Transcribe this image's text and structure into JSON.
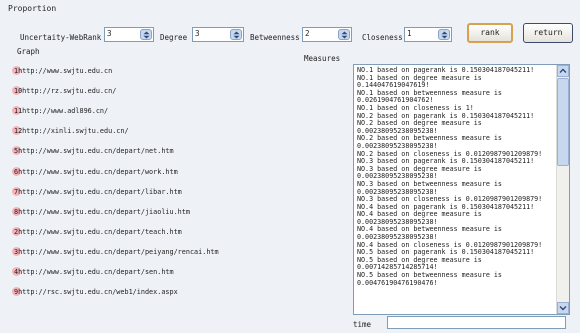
{
  "title": "Proportion",
  "weights": [
    {
      "label": "Uncertaity-WebRank",
      "value": "3"
    },
    {
      "label": "Degree",
      "value": "3"
    },
    {
      "label": "Betweenness",
      "value": "2"
    },
    {
      "label": "Closeness",
      "value": "1"
    }
  ],
  "buttons": {
    "rank": "rank",
    "return": "return"
  },
  "graph": {
    "label": "Graph",
    "items": [
      "1http://www.swjtu.edu.cn",
      "10http://rz.swjtu.edu.cn/",
      "11http://www.adl896.cn/",
      "12http://xinli.swjtu.edu.cn/",
      "5http://www.swjtu.edu.cn/depart/net.htm",
      "6http://www.swjtu.edu.cn/depart/work.htm",
      "7http://www.swjtu.edu.cn/depart/libar.htm",
      "8http://www.swjtu.edu.cn/depart/jiaoliu.htm",
      "2http://www.swjtu.edu.cn/depart/teach.htm",
      "3http://www.swjtu.edu.cn/depart/peiyang/rencai.htm",
      "4http://www.swjtu.edu.cn/depart/sen.htm",
      "9http://rsc.swjtu.edu.cn/web1/index.aspx"
    ]
  },
  "measures": {
    "label": "Measures",
    "lines": [
      "NO.1 based on pagerank is 0.150304187045211!",
      "NO.1 based on degree measure is",
      "0.144047619047619!",
      "NO.1 based on betweenness measure is",
      "0.0261904761904762!",
      "NO.1 based on closeness is 1!",
      "NO.2 based on pagerank is 0.150304187045211!",
      "NO.2 based on degree measure is",
      "0.00238095238095238!",
      "NO.2 based on betweenness measure is",
      "0.00238095238095238!",
      "NO.2 based on closeness is 0.0120987901209879!",
      "NO.3 based on pagerank is 0.150304187045211!",
      "NO.3 based on degree measure is",
      "0.00238095238095238!",
      "NO.3 based on betweenness measure is",
      "0.00238095238095238!",
      "NO.3 based on closeness is 0.0120987901209879!",
      "NO.4 based on pagerank is 0.150304187045211!",
      "NO.4 based on degree measure is",
      "0.00238095238095238!",
      "NO.4 based on betweenness measure is",
      "0.00238095238095238!",
      "NO.4 based on closeness is 0.0120987901209879!",
      "NO.5 based on pagerank is 0.150304187045211!",
      "NO.5 based on degree measure is",
      "0.00714285714285714!",
      "NO.5 based on betweenness measure is",
      "0.00476190476190476!"
    ]
  },
  "time": {
    "label": "time",
    "value": ""
  },
  "icons": {
    "spin": "spin-arrows-icon",
    "scroll_up": "arrow-up-icon",
    "scroll_down": "arrow-down-icon"
  }
}
